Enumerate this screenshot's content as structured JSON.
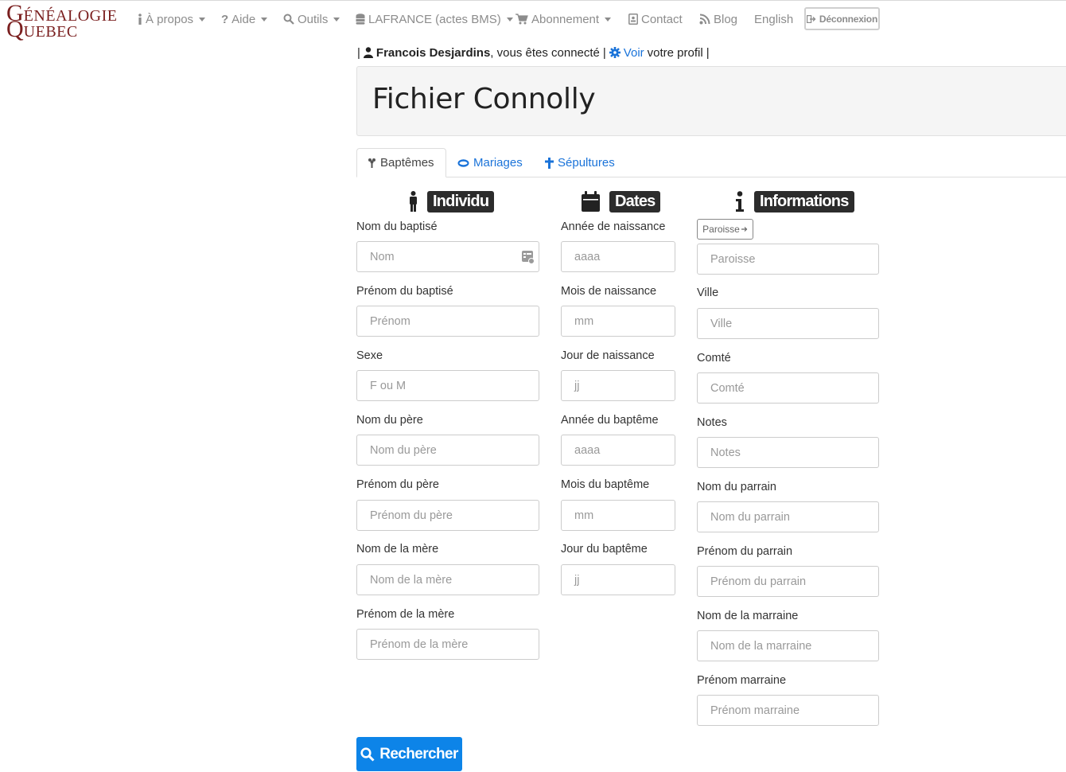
{
  "logo": {
    "line1_initial": "G",
    "line1_rest": "ÉNÉALOGIE",
    "line2_initial": "Q",
    "line2_rest": "UEBEC"
  },
  "nav": {
    "about": "À propos",
    "help": "Aide",
    "tools": "Outils",
    "lafrance": "LAFRANCE (actes BMS)",
    "subscription": "Abonnement",
    "contact": "Contact",
    "blog": "Blog",
    "english": "English",
    "logout": "Déconnexion"
  },
  "session": {
    "user": "Francois Desjardins",
    "connected_text": ", vous êtes connecté",
    "profile_link": "Voir",
    "profile_text": "votre profil",
    "separator": "|"
  },
  "page_title": "Fichier Connolly",
  "tabs": [
    {
      "label": "Baptêmes",
      "active": true
    },
    {
      "label": "Mariages",
      "active": false
    },
    {
      "label": "Sépultures",
      "active": false
    }
  ],
  "sections": {
    "individual": "Individu",
    "dates": "Dates",
    "information": "Informations"
  },
  "individual_fields": [
    {
      "label": "Nom du baptisé",
      "placeholder": "Nom"
    },
    {
      "label": "Prénom du baptisé",
      "placeholder": "Prénom"
    },
    {
      "label": "Sexe",
      "placeholder": "F ou M"
    },
    {
      "label": "Nom du père",
      "placeholder": "Nom du père"
    },
    {
      "label": "Prénom du père",
      "placeholder": "Prénom du père"
    },
    {
      "label": "Nom de la mère",
      "placeholder": "Nom de la mère"
    },
    {
      "label": "Prénom de la mère",
      "placeholder": "Prénom de la mère"
    }
  ],
  "date_fields": [
    {
      "label": "Année de naissance",
      "placeholder": "aaaa"
    },
    {
      "label": "Mois de naissance",
      "placeholder": "mm"
    },
    {
      "label": "Jour de naissance",
      "placeholder": "jj"
    },
    {
      "label": "Année du baptême",
      "placeholder": "aaaa"
    },
    {
      "label": "Mois du baptême",
      "placeholder": "mm"
    },
    {
      "label": "Jour du baptême",
      "placeholder": "jj"
    }
  ],
  "info": {
    "parish_button": "Paroisse",
    "parish_placeholder": "Paroisse",
    "fields": [
      {
        "label": "Ville",
        "placeholder": "Ville"
      },
      {
        "label": "Comté",
        "placeholder": "Comté"
      },
      {
        "label": "Notes",
        "placeholder": "Notes"
      },
      {
        "label": "Nom du parrain",
        "placeholder": "Nom du parrain"
      },
      {
        "label": "Prénom du parrain",
        "placeholder": "Prénom du parrain"
      },
      {
        "label": "Nom de la marraine",
        "placeholder": "Nom de la marraine"
      },
      {
        "label": "Prénom marraine",
        "placeholder": "Prénom marraine"
      }
    ]
  },
  "search_button": "Rechercher",
  "colors": {
    "link": "#1a73d9",
    "primary_button": "#0d84e8",
    "logo": "#7a1f1f",
    "badge": "#2c2c2c"
  }
}
